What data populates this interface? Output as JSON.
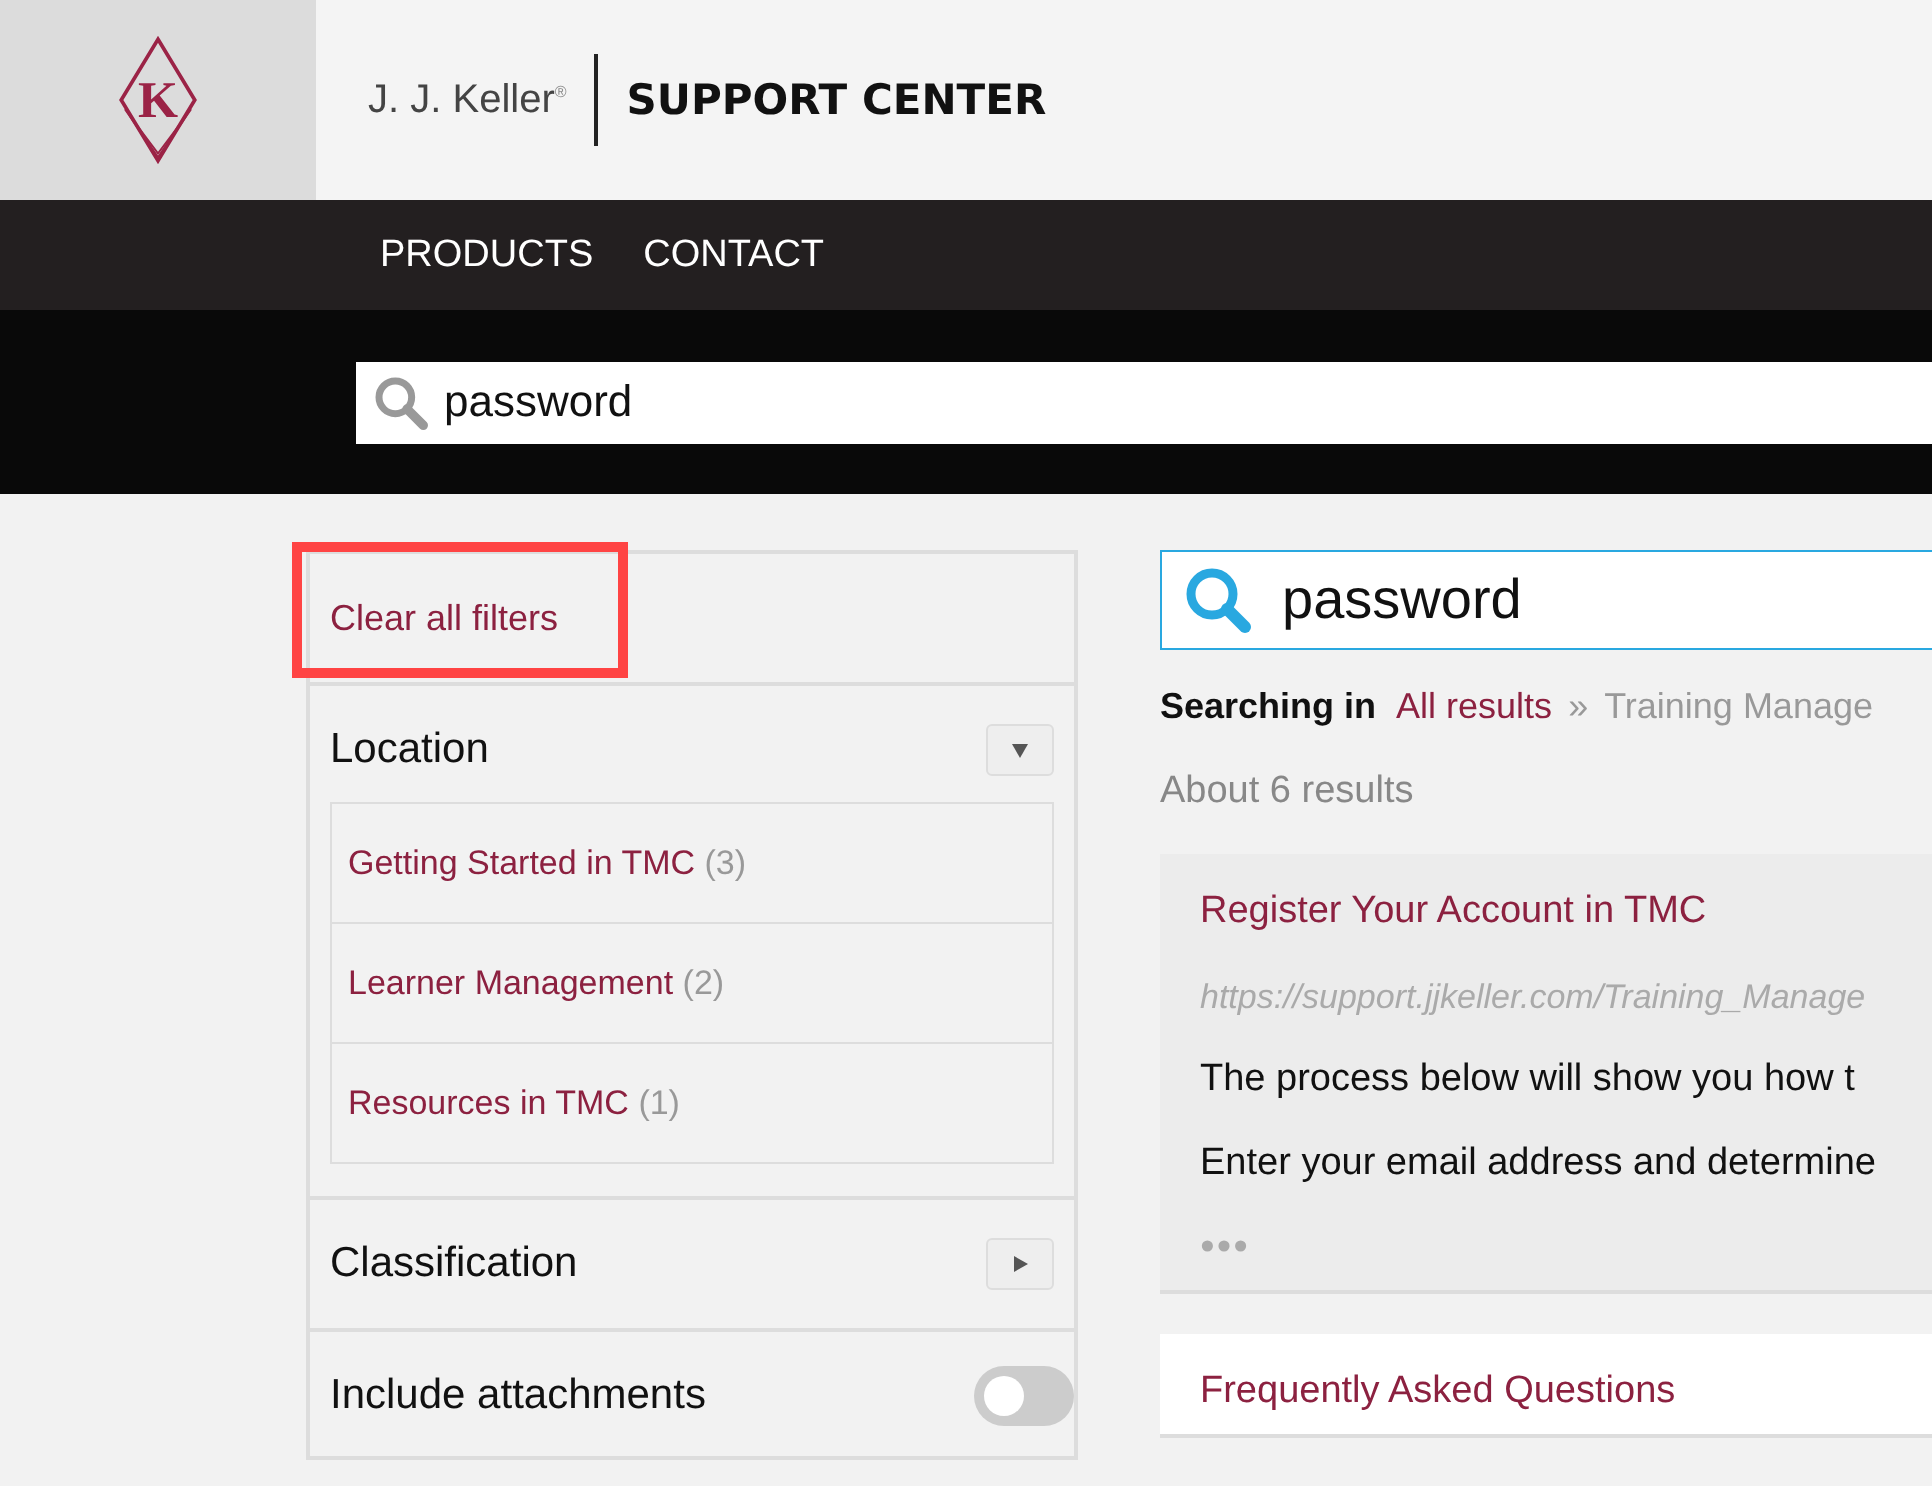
{
  "header": {
    "logo_letter": "K",
    "brand": "J. J. Keller",
    "brand_mark": "®",
    "title": "SUPPORT CENTER"
  },
  "nav": [
    "PRODUCTS",
    "CONTACT"
  ],
  "top_search": {
    "value": "password"
  },
  "sidebar": {
    "clear_filters": "Clear all filters",
    "highlighted": true,
    "sections": [
      {
        "kind": "facet",
        "title": "Location",
        "expanded": true,
        "items": [
          {
            "label": "Getting Started in TMC",
            "count": "(3)"
          },
          {
            "label": "Learner Management",
            "count": "(2)"
          },
          {
            "label": "Resources in TMC",
            "count": "(1)"
          }
        ]
      },
      {
        "kind": "facet",
        "title": "Classification",
        "expanded": false
      },
      {
        "kind": "toggle",
        "title": "Include attachments",
        "on": false
      }
    ]
  },
  "search": {
    "value": "password"
  },
  "scope": {
    "label": "Searching in",
    "link": "All results",
    "separator": "»",
    "current": "Training Manage"
  },
  "result_count": "About 6 results",
  "results": [
    {
      "title": "Register Your Account in TMC",
      "url": "https://support.jjkeller.com/Training_Manage",
      "lines": [
        "The process below will show you how t",
        "Enter your email address and determine"
      ],
      "more": true,
      "selected": true
    },
    {
      "title": "Frequently Asked Questions",
      "selected": false
    }
  ]
}
